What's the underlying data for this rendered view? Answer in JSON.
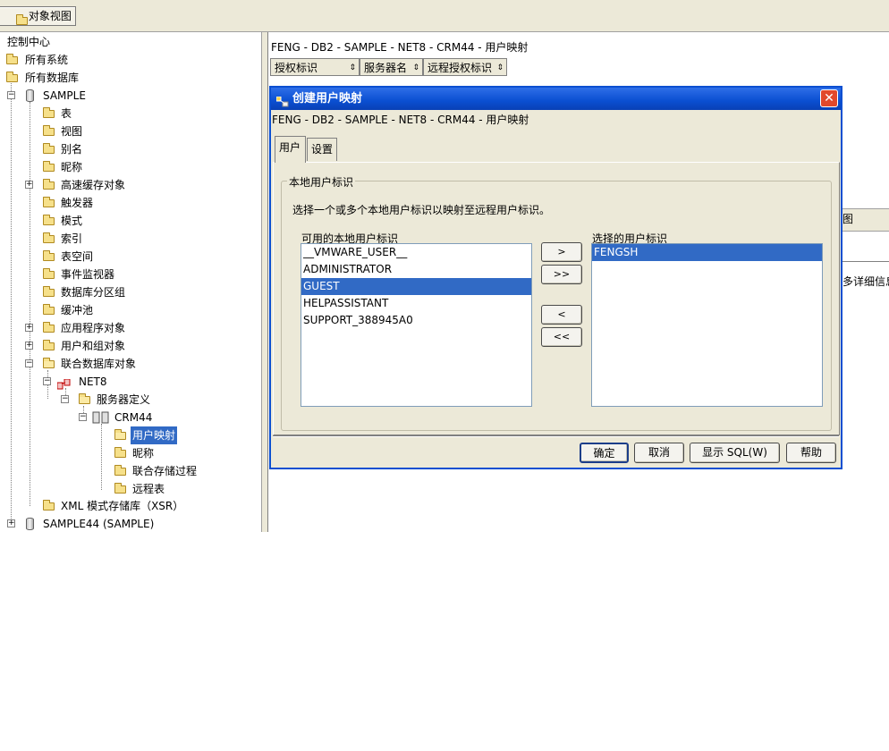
{
  "toolbar": {
    "object_view_tab": "对象视图"
  },
  "tree": {
    "control_center": "控制中心",
    "all_systems": "所有系统",
    "all_databases": "所有数据库",
    "sample": "SAMPLE",
    "tables": "表",
    "views": "视图",
    "aliases": "别名",
    "nicknames": "昵称",
    "cache_objects": "高速缓存对象",
    "triggers": "触发器",
    "schemas": "模式",
    "indexes": "索引",
    "tablespaces": "表空间",
    "event_monitors": "事件监视器",
    "partition_groups": "数据库分区组",
    "bufferpools": "缓冲池",
    "app_objects": "应用程序对象",
    "user_group_objects": "用户和组对象",
    "federated_objects": "联合数据库对象",
    "net8": "NET8",
    "server_definitions": "服务器定义",
    "crm44": "CRM44",
    "user_mappings": "用户映射",
    "crm_nicknames": "昵称",
    "federated_procs": "联合存储过程",
    "remote_tables": "远程表",
    "xsr": "XML 模式存储库（XSR）",
    "sample44": "SAMPLE44 (SAMPLE)"
  },
  "right_pane": {
    "title": "FENG - DB2 - SAMPLE - NET8 - CRM44 - 用户映射",
    "columns": [
      "授权标识",
      "服务器名",
      "远程授权标识"
    ],
    "partial_tab": "图",
    "partial_text": "多详细信息"
  },
  "dialog": {
    "title": "创建用户映射",
    "path": "FENG - DB2 - SAMPLE - NET8 - CRM44 - 用户映射",
    "tabs": [
      "用户",
      "设置"
    ],
    "group_title": "本地用户标识",
    "description": "选择一个或多个本地用户标识以映射至远程用户标识。",
    "available_label": "可用的本地用户标识",
    "selected_label": "选择的用户标识",
    "available_users": [
      "__VMWARE_USER__",
      "ADMINISTRATOR",
      "GUEST",
      "HELPASSISTANT",
      "SUPPORT_388945A0"
    ],
    "selected_available_user": "GUEST",
    "selected_users": [
      "FENGSH"
    ],
    "move_buttons": {
      "add": ">",
      "add_all": ">>",
      "remove": "<",
      "remove_all": "<<"
    },
    "buttons": {
      "ok": "确定",
      "cancel": "取消",
      "show_sql": "显示 SQL(W)",
      "help": "帮助"
    }
  }
}
